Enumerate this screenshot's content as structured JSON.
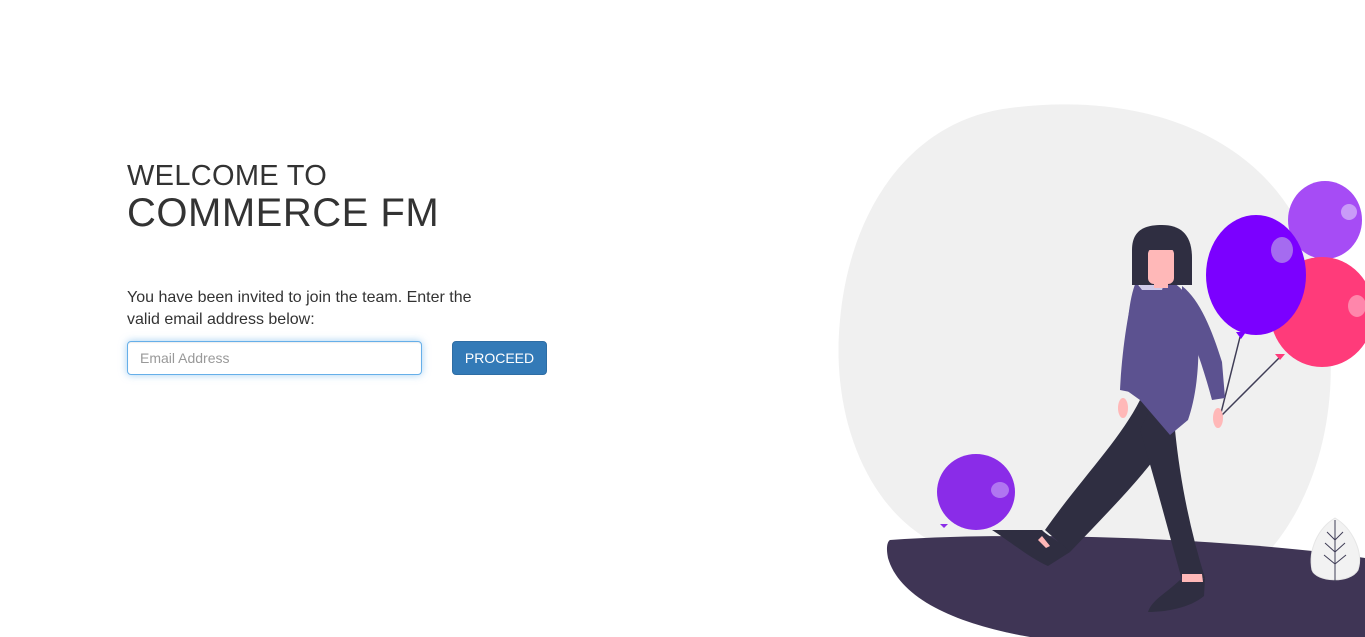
{
  "welcome": {
    "line1": "WELCOME TO",
    "line2": "COMMERCE FM"
  },
  "invite": {
    "message": "You have been invited to join the team. Enter the valid email address below:"
  },
  "form": {
    "email_placeholder": "Email Address",
    "email_value": "",
    "proceed_label": "PROCEED"
  },
  "colors": {
    "primary_button": "#337ab7",
    "text": "#333333",
    "balloon_purple": "#8a2ce8",
    "balloon_violet": "#a64cf5",
    "balloon_pink": "#ff3b7a",
    "ground": "#3f3555",
    "blob": "#f0f0f0"
  },
  "illustration": {
    "icon": "woman-with-balloons-illustration"
  }
}
